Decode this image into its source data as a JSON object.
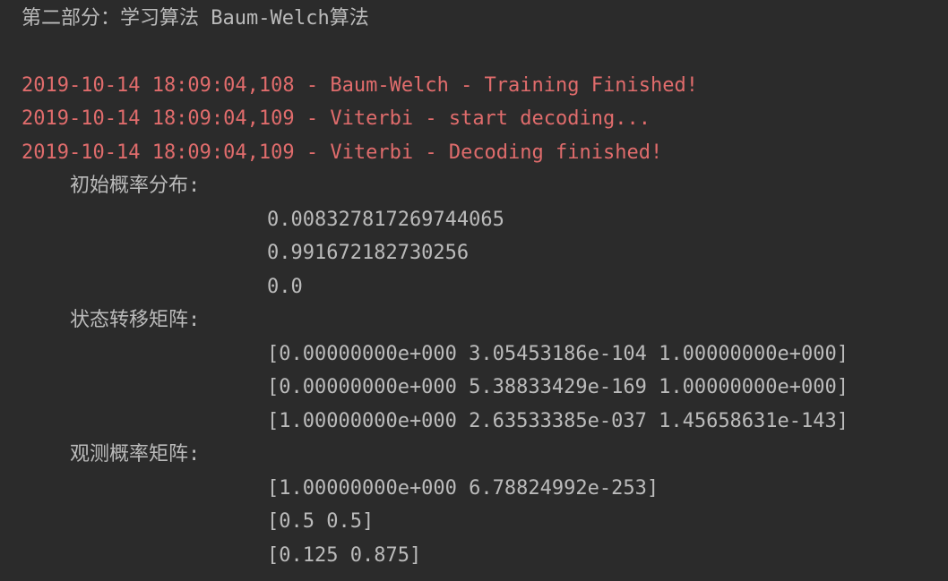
{
  "console": {
    "heading": "第二部分：学习算法 Baum-Welch算法",
    "log_lines": [
      "2019-10-14 18:09:04,108 - Baum-Welch - Training Finished!",
      "2019-10-14 18:09:04,109 - Viterbi - start decoding...",
      "2019-10-14 18:09:04,109 - Viterbi - Decoding finished!"
    ],
    "log_color": "#e06c6c",
    "text_color": "#bbbbbb",
    "background": "#2b2b2b",
    "initial_distribution": {
      "label": "初始概率分布:",
      "values": [
        "0.008327817269744065",
        "0.991672182730256",
        "0.0"
      ]
    },
    "transition_matrix": {
      "label": "状态转移矩阵:",
      "rows": [
        "[0.00000000e+000 3.05453186e-104 1.00000000e+000]",
        "[0.00000000e+000 5.38833429e-169 1.00000000e+000]",
        "[1.00000000e+000 2.63533385e-037 1.45658631e-143]"
      ]
    },
    "observation_matrix": {
      "label": "观测概率矩阵:",
      "rows": [
        "[1.00000000e+000 6.78824992e-253]",
        "[0.5 0.5]",
        "[0.125 0.875]"
      ]
    }
  }
}
